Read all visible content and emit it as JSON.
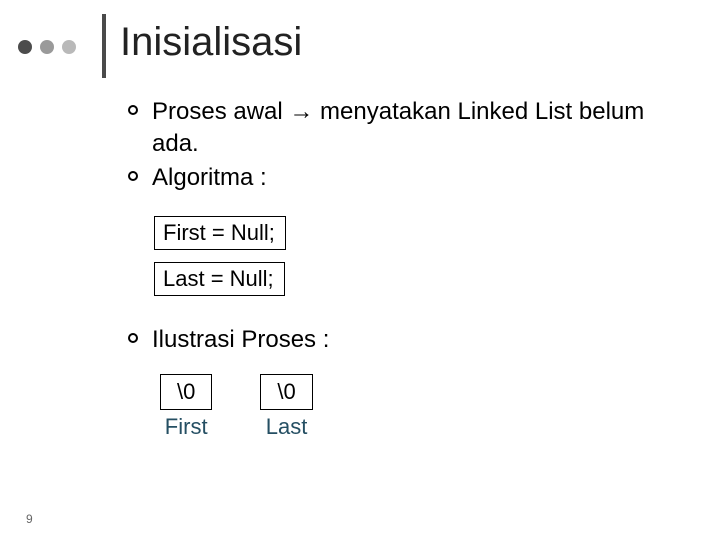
{
  "title": "Inisialisasi",
  "bullets": {
    "b1": "Proses awal → menyatakan Linked List belum ada.",
    "b2": "Algoritma :",
    "b3": "Ilustrasi Proses :"
  },
  "code": {
    "line1": "First = Null;",
    "line2": "Last = Null;"
  },
  "illustration": {
    "first_box": "\\0",
    "first_label": "First",
    "last_box": "\\0",
    "last_label": "Last"
  },
  "page_number": "9"
}
